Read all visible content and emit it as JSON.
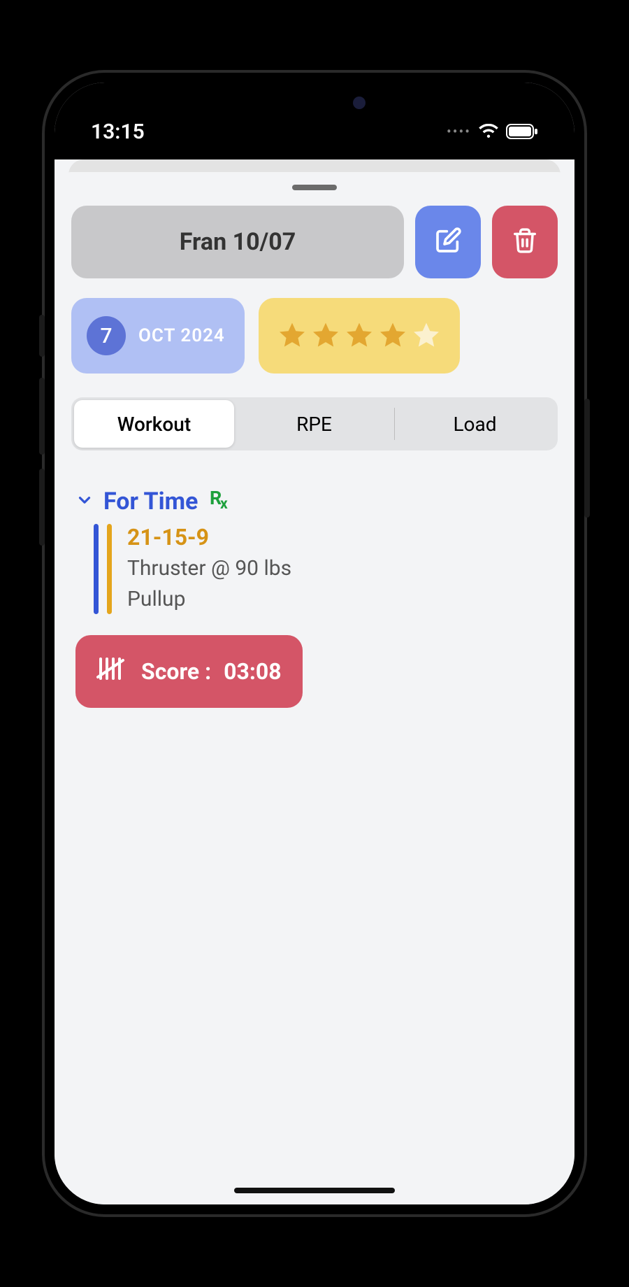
{
  "status": {
    "time": "13:15"
  },
  "header": {
    "title": "Fran 10/07"
  },
  "date": {
    "day": "7",
    "month_year": "OCT 2024"
  },
  "rating": {
    "stars": 4,
    "max": 5
  },
  "tabs": {
    "items": [
      "Workout",
      "RPE",
      "Load"
    ],
    "active": 0
  },
  "workout": {
    "section_title": "For Time",
    "rx_label": "Rx",
    "reps_scheme": "21-15-9",
    "movements": [
      "Thruster @ 90 lbs",
      "Pullup"
    ]
  },
  "score": {
    "label": "Score :",
    "value": "03:08"
  }
}
